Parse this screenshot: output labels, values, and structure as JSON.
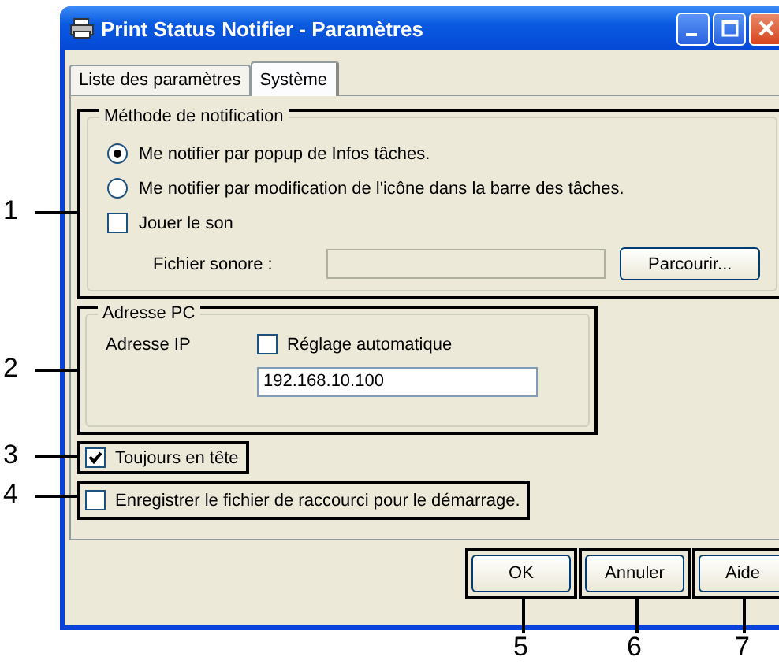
{
  "window": {
    "title": "Print Status Notifier - Paramètres"
  },
  "tabs": [
    {
      "label": "Liste des paramètres",
      "selected": false
    },
    {
      "label": "Système",
      "selected": true
    }
  ],
  "notification_group": {
    "callout": "1",
    "title": "Méthode de notification",
    "options": [
      {
        "label": "Me notifier par popup de Infos tâches.",
        "selected": true
      },
      {
        "label": "Me notifier par modification de l'icône dans la barre des tâches.",
        "selected": false
      }
    ],
    "play_sound": {
      "label": "Jouer le son",
      "checked": false
    },
    "sound_file": {
      "label": "Fichier sonore :",
      "disabled": true
    },
    "browse_button": "Parcourir..."
  },
  "pc_address_group": {
    "callout": "2",
    "title": "Adresse PC",
    "ip_label": "Adresse IP",
    "auto_setting": {
      "label": "Réglage automatique",
      "checked": false
    },
    "ip_value": "192.168.10.100"
  },
  "always_on_top": {
    "callout": "3",
    "label": "Toujours en tête",
    "checked": true
  },
  "startup_shortcut": {
    "callout": "4",
    "label": "Enregistrer le fichier de raccourci pour le démarrage.",
    "checked": false
  },
  "buttons": [
    {
      "label": "OK",
      "callout": "5"
    },
    {
      "label": "Annuler",
      "callout": "6"
    },
    {
      "label": "Aide",
      "callout": "7"
    }
  ]
}
